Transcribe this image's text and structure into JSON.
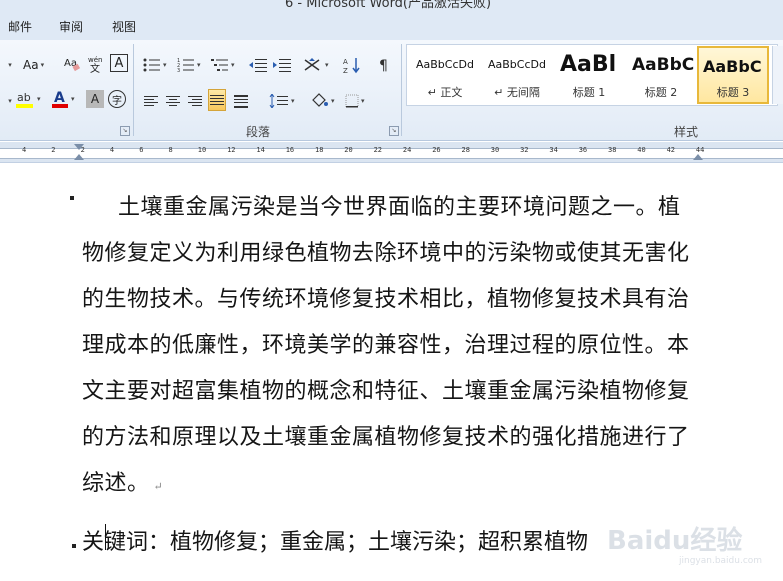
{
  "window": {
    "title": "6 - Microsoft Word(产品激活失败)"
  },
  "tabs": [
    {
      "label": "邮件"
    },
    {
      "label": "审阅"
    },
    {
      "label": "视图"
    }
  ],
  "ribbon": {
    "font_group": {
      "change_case_label": "Aa",
      "phonetic_label": "文",
      "border_label": "A",
      "shade_label": "A",
      "enclose_label": "字",
      "font_color_label": "A",
      "highlight_color": "#ffff00",
      "font_color": "#e00000"
    },
    "paragraph_group": {
      "label": "段落"
    },
    "styles_group": {
      "label": "样式",
      "items": [
        {
          "sample": "AaBbCcDd",
          "name": "↵ 正文"
        },
        {
          "sample": "AaBbCcDd",
          "name": "↵ 无间隔"
        },
        {
          "sample": "AaBl",
          "name": "标题 1"
        },
        {
          "sample": "AaBbC",
          "name": "标题 2"
        },
        {
          "sample": "AaBbC",
          "name": "标题 3"
        }
      ],
      "selected_index": 4
    }
  },
  "ruler": {
    "numbers": [
      "4",
      "2",
      "2",
      "4",
      "6",
      "8",
      "10",
      "12",
      "14",
      "16",
      "18",
      "20",
      "22",
      "24",
      "26",
      "28",
      "30",
      "32",
      "34",
      "36",
      "38",
      "40",
      "42",
      "44"
    ]
  },
  "document": {
    "paragraph": "土壤重金属污染是当今世界面临的主要环境问题之一。植物修复定义为利用绿色植物去除环境中的污染物或使其无害化的生物技术。与传统环境修复技术相比，植物修复技术具有治理成本的低廉性，环境美学的兼容性，治理过程的原位性。本文主要对超富集植物的概念和特征、土壤重金属污染植物修复的方法和原理以及土壤重金属植物修复技术的强化措施进行了综述。",
    "paragraph_mark": "↵",
    "keywords": "关键词：植物修复；重金属；土壤污染；超积累植物"
  },
  "watermark": {
    "text": "Baidu经验",
    "sub": "jingyan.baidu.com"
  }
}
